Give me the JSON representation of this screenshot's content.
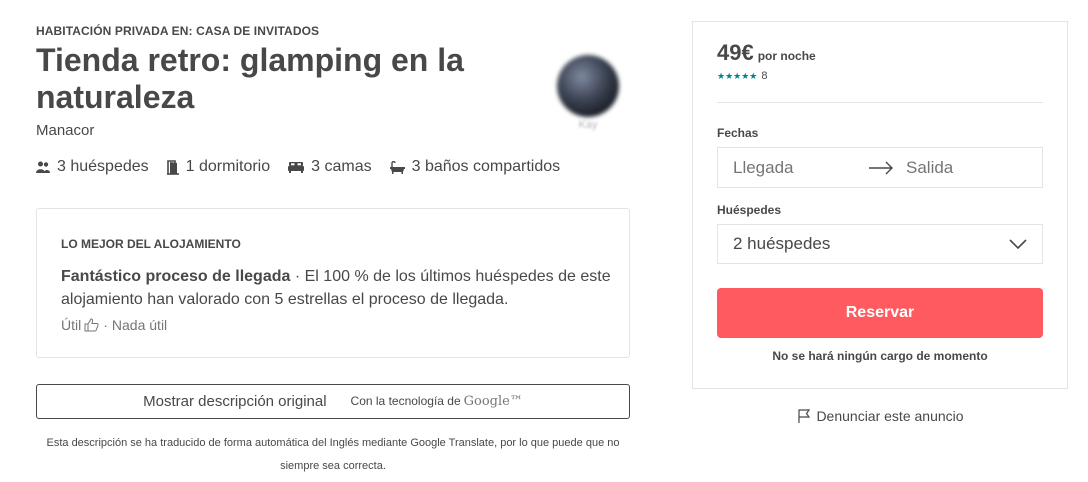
{
  "listing": {
    "kicker": "HABITACIÓN PRIVADA EN: CASA DE INVITADOS",
    "title": "Tienda retro: glamping en la naturaleza",
    "location": "Manacor",
    "host_name": "Kay"
  },
  "amenities": [
    {
      "icon": "guests-icon",
      "label": "3 huéspedes"
    },
    {
      "icon": "door-icon",
      "label": "1 dormitorio"
    },
    {
      "icon": "bed-icon",
      "label": "3 camas"
    },
    {
      "icon": "bathtub-icon",
      "label": "3 baños compartidos"
    }
  ],
  "highlight": {
    "heading": "LO MEJOR DEL ALOJAMIENTO",
    "bold": "Fantástico proceso de llegada",
    "text": " · El 100 % de los últimos huéspedes de este alojamiento han valorado con 5 estrellas el proceso de llegada.",
    "helpful": "Útil",
    "separator": "·",
    "not_helpful": "Nada útil"
  },
  "translate": {
    "button_label": "Mostrar descripción original",
    "powered_by": "Con la tecnología de",
    "brand": "Google™",
    "disclaimer": "Esta descripción se ha traducido de forma automática del Inglés mediante Google Translate, por lo que puede que no siempre sea correcta."
  },
  "booking": {
    "price": "49€",
    "per_night": "por noche",
    "stars": "★★★★★",
    "review_count": "8",
    "dates_label": "Fechas",
    "checkin_placeholder": "Llegada",
    "checkout_placeholder": "Salida",
    "guests_label": "Huéspedes",
    "guests_value": "2 huéspedes",
    "reserve_label": "Reservar",
    "no_charge": "No se hará ningún cargo de momento",
    "accent_color": "#ff5a5f",
    "star_color": "#008489"
  },
  "report": {
    "label": "Denunciar este anuncio",
    "icon": "flag-icon"
  }
}
